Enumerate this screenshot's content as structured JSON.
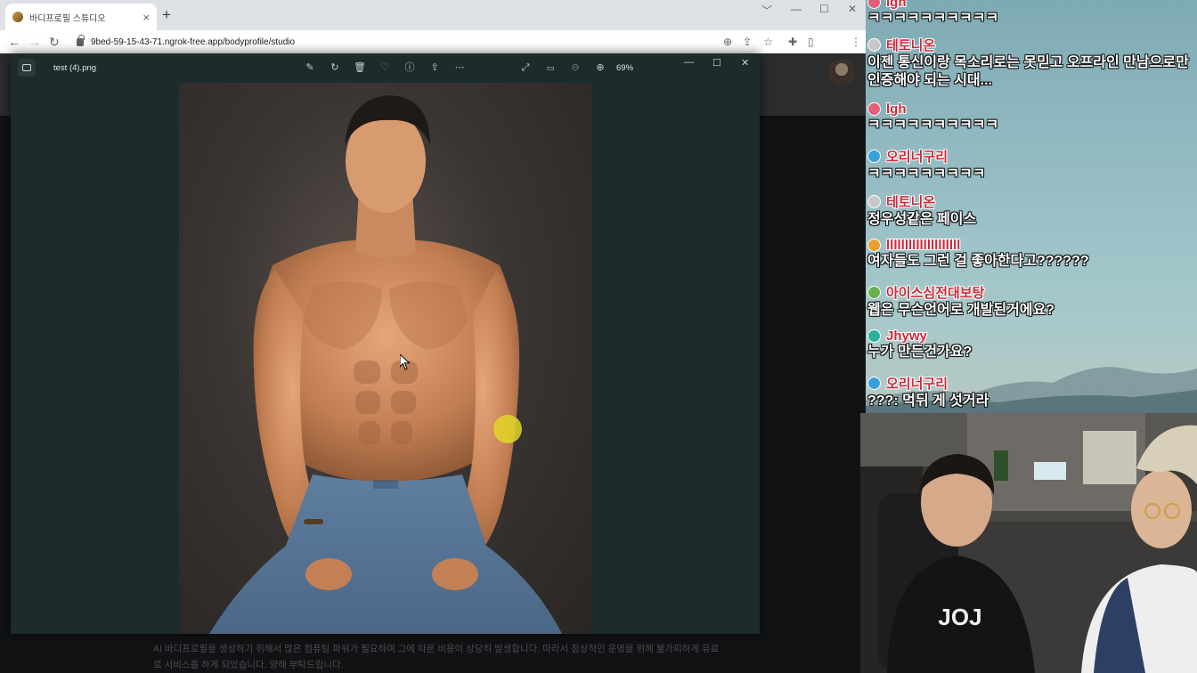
{
  "browser": {
    "tab_title": "바디프로필 스튜디오",
    "tab_close": "×",
    "new_tab": "+",
    "url": "9bed-59-15-43-71.ngrok-free.app/bodyprofile/studio",
    "window_controls": [
      "﹀",
      "—",
      "☐",
      "✕"
    ]
  },
  "viewer": {
    "filename": "test (4).png",
    "zoom": "69%"
  },
  "page": {
    "notice": "AI 바디프로필을 생성하기 위해서 많은 컴퓨팅 파워가 필요하며 그에 따른 비용이 상당히 발생합니다. 따라서 정상적인 운영을 위해 불가피하게 유료로 서비스를 하게 되었습니다. 양해 부탁드립니다."
  },
  "chat": {
    "messages": [
      {
        "user": "lgh",
        "text": "ㅋㅋㅋㅋㅋㅋㅋㅋㅋㅋ",
        "badge_color": "#e0607a"
      },
      {
        "user": "테토니온",
        "text": "이젠 통신이랑 목소리로는 못믿고 오프라인 만남으로만 인증해야 되는 시대...",
        "badge_color": "#c8c8c8"
      },
      {
        "user": "lgh",
        "text": "ㅋㅋㅋㅋㅋㅋㅋㅋㅋㅋ",
        "badge_color": "#e0607a"
      },
      {
        "user": "오리너구리",
        "text": "ㅋㅋㅋㅋㅋㅋㅋㅋㅋ",
        "badge_color": "#3a9fd8"
      },
      {
        "user": "테토니온",
        "text": "정우성같은 페이스",
        "badge_color": "#c8c8c8"
      },
      {
        "user": "llllllllllllllllllll",
        "text": "여자들도 그런 걸 좋아한다고??????",
        "badge_color": "#e8a030"
      },
      {
        "user": "아이스심전대보탕",
        "text": "웹은 무슨언어로 개발된거에요?",
        "badge_color": "#6ab04c"
      },
      {
        "user": "Jhywy",
        "text": "누가 만든건가요?",
        "badge_color": "#2ab39a"
      },
      {
        "user": "오리너구리",
        "text": "???: 먹뒤 게 섯거라",
        "badge_color": "#3a9fd8"
      }
    ]
  },
  "webcam": {
    "shirt_text": "JOJ"
  },
  "colors": {
    "viewer_bg": "#1c2b2b",
    "chat_username": "#cc2a3a",
    "cursor_highlight": "#e2d628"
  }
}
